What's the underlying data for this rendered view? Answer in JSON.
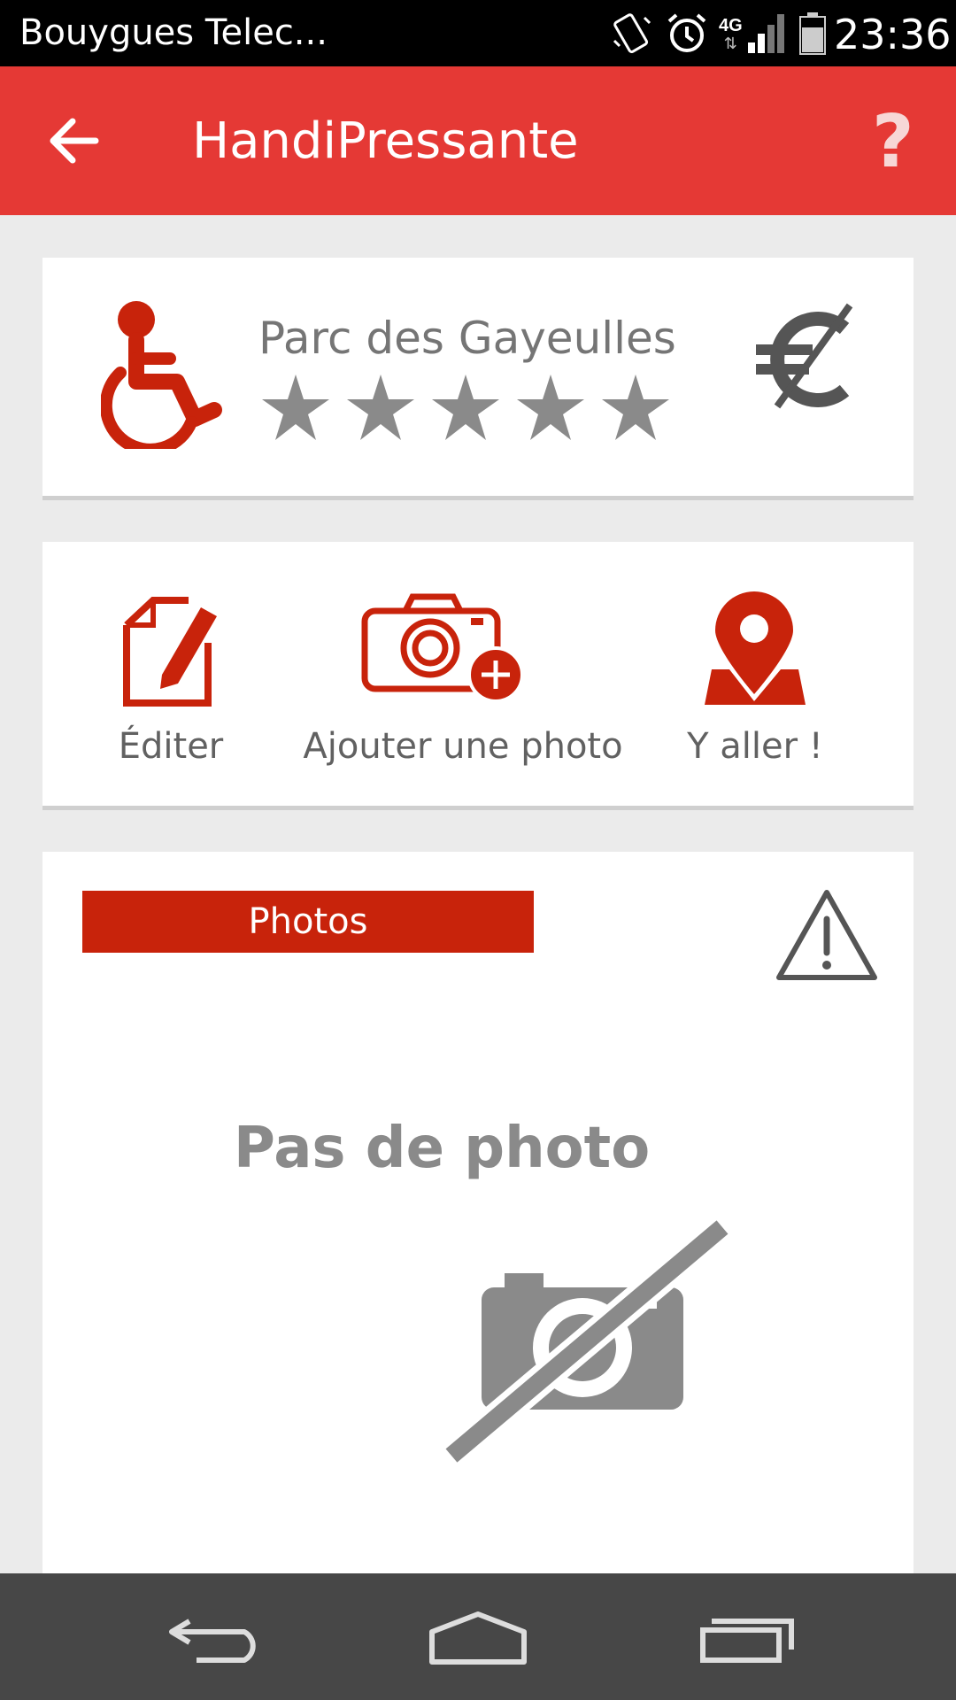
{
  "status_bar": {
    "carrier": "Bouygues Telec...",
    "network": "4G",
    "time": "23:36",
    "icons": [
      "vibrate-icon",
      "alarm-icon",
      "network-4g-icon",
      "signal-icon",
      "battery-icon"
    ]
  },
  "app_bar": {
    "title": "HandiPressante",
    "back_icon": "arrow-back-icon",
    "help_label": "?"
  },
  "place": {
    "name": "Parc des Gayeulles",
    "rating": 5,
    "rating_max": 5,
    "accessibility_icon": "wheelchair-icon",
    "price_icon": "euro-icon"
  },
  "actions": [
    {
      "label": "Éditer",
      "icon": "edit-icon"
    },
    {
      "label": "Ajouter une photo",
      "icon": "add-photo-icon"
    },
    {
      "label": "Y aller !",
      "icon": "map-pin-icon"
    }
  ],
  "photos": {
    "tab_label": "Photos",
    "empty_text": "Pas de photo",
    "warning_icon": "warning-icon"
  },
  "nav_bar": {
    "buttons": [
      "back-nav-icon",
      "home-nav-icon",
      "recents-nav-icon"
    ]
  },
  "colors": {
    "app_bar": "#e53935",
    "accent_red": "#c8230b",
    "text_gray": "#757575"
  }
}
